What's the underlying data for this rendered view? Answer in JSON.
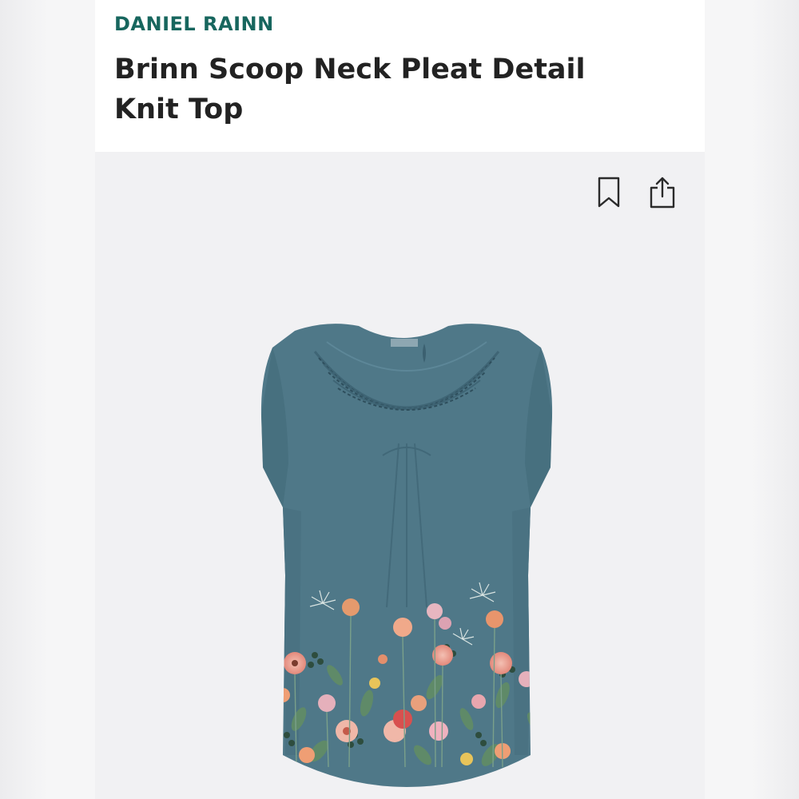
{
  "product": {
    "brand": "DANIEL RAINN",
    "title": "Brinn Scoop Neck Pleat Detail Knit Top"
  },
  "actions": {
    "bookmark_icon": "bookmark-icon",
    "share_icon": "share-icon"
  },
  "colors": {
    "brand": "#17665e",
    "garment": "#4f7888",
    "background": "#f1f1f3"
  }
}
